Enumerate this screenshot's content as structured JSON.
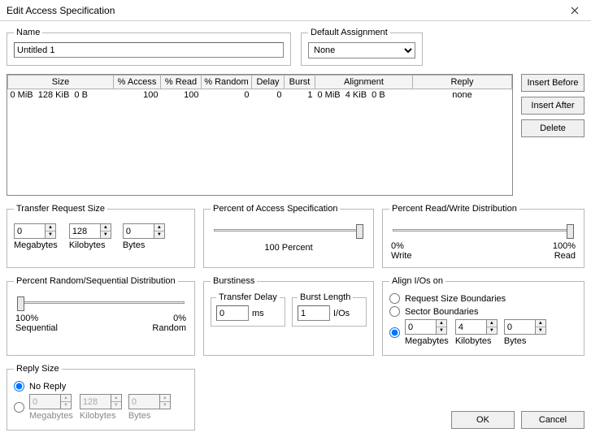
{
  "window": {
    "title": "Edit Access Specification"
  },
  "name": {
    "legend": "Name",
    "value": "Untitled 1"
  },
  "default_assignment": {
    "legend": "Default Assignment",
    "value": "None"
  },
  "grid": {
    "headers": [
      "Size",
      "% Access",
      "% Read",
      "% Random",
      "Delay",
      "Burst",
      "Alignment",
      "Reply"
    ],
    "row": {
      "size_mib": "0 MiB",
      "size_kib": "128 KiB",
      "size_b": "0 B",
      "access": "100",
      "read": "100",
      "random": "0",
      "delay": "0",
      "burst": "1",
      "align_mib": "0 MiB",
      "align_kib": "4 KiB",
      "align_b": "0 B",
      "reply": "none"
    }
  },
  "buttons": {
    "insert_before": "Insert Before",
    "insert_after": "Insert After",
    "delete": "Delete",
    "ok": "OK",
    "cancel": "Cancel"
  },
  "transfer": {
    "legend": "Transfer Request Size",
    "mb": "0",
    "kb": "128",
    "b": "0",
    "mb_label": "Megabytes",
    "kb_label": "Kilobytes",
    "b_label": "Bytes"
  },
  "percent_access": {
    "legend": "Percent of Access Specification",
    "label": "100 Percent",
    "pos": 100
  },
  "percent_rw": {
    "legend": "Percent Read/Write Distribution",
    "left_pct": "0%",
    "right_pct": "100%",
    "left_lbl": "Write",
    "right_lbl": "Read",
    "pos": 100
  },
  "percent_rs": {
    "legend": "Percent Random/Sequential Distribution",
    "left_pct": "100%",
    "right_pct": "0%",
    "left_lbl": "Sequential",
    "right_lbl": "Random",
    "pos": 0
  },
  "burstiness": {
    "legend": "Burstiness",
    "delay_legend": "Transfer Delay",
    "delay_val": "0",
    "delay_unit": "ms",
    "length_legend": "Burst Length",
    "length_val": "1",
    "length_unit": "I/Os"
  },
  "align": {
    "legend": "Align I/Os on",
    "opt_request": "Request Size Boundaries",
    "opt_sector": "Sector Boundaries",
    "mb": "0",
    "kb": "4",
    "b": "0",
    "mb_label": "Megabytes",
    "kb_label": "Kilobytes",
    "b_label": "Bytes"
  },
  "reply": {
    "legend": "Reply Size",
    "no_reply": "No Reply",
    "mb": "0",
    "kb": "128",
    "b": "0",
    "mb_label": "Megabytes",
    "kb_label": "Kilobytes",
    "b_label": "Bytes"
  }
}
